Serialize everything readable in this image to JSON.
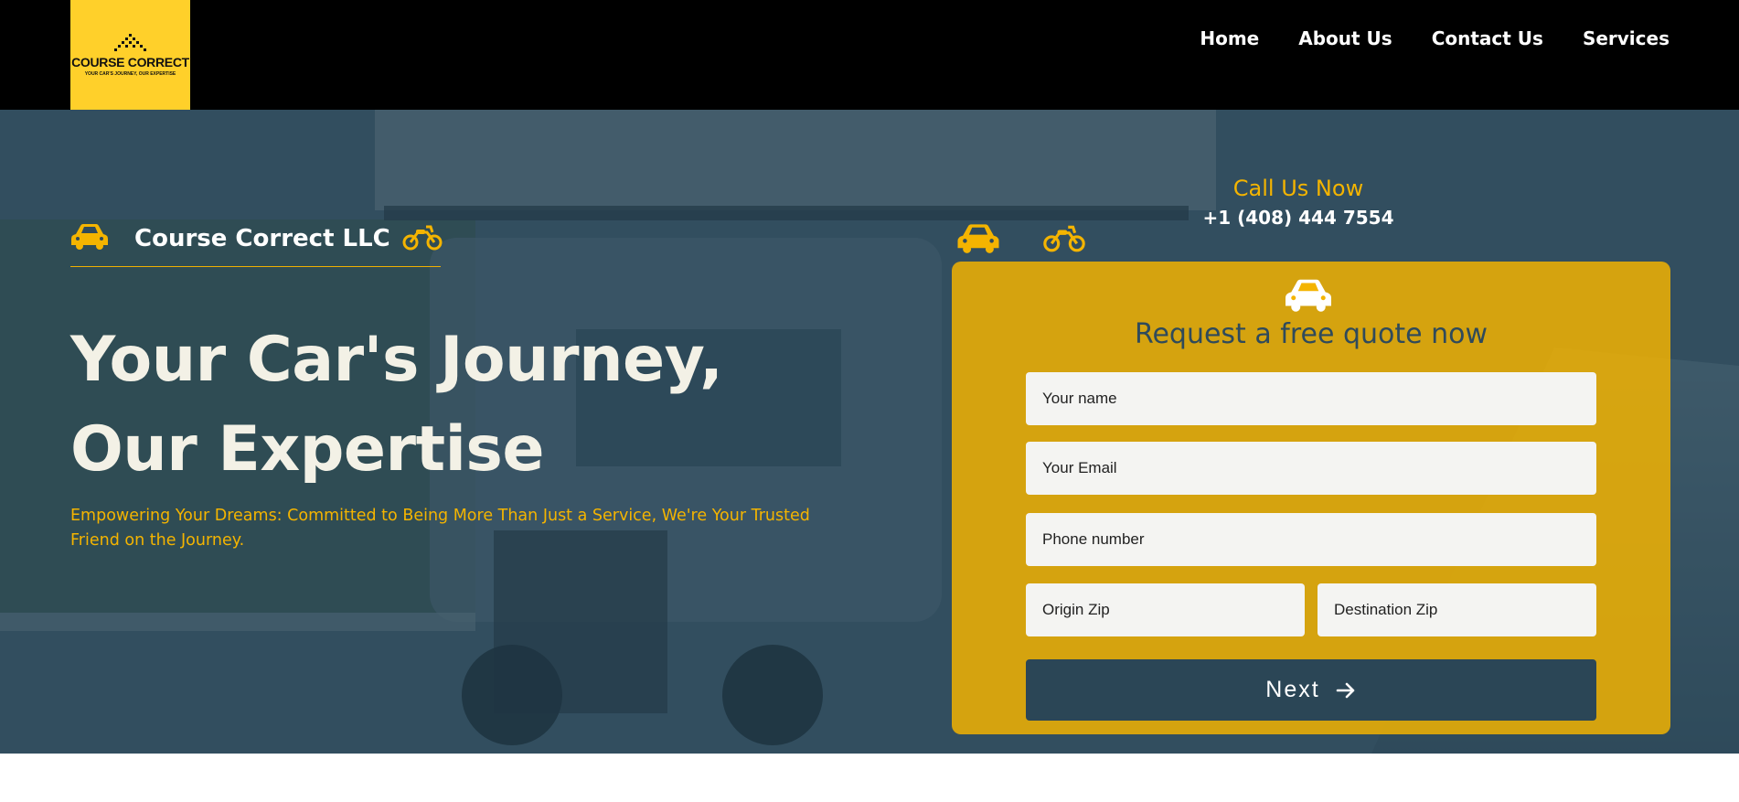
{
  "header": {
    "logo_name": "COURSE CORRECT",
    "logo_tagline": "YOUR CAR'S JOURNEY, OUR EXPERTISE",
    "nav": [
      "Home",
      "About Us",
      "Contact Us",
      "Services"
    ]
  },
  "hero": {
    "brand_name": "Course Correct LLC",
    "headline_line1": "Your Car's Journey,",
    "headline_line2": "Our Expertise",
    "tagline": "Empowering Your Dreams: Committed to Being More Than Just a Service, We're Your Trusted Friend on the Journey.",
    "call_title": "Call Us Now",
    "call_phone": "+1 (408) 444 7554"
  },
  "quote_form": {
    "title": "Request a free quote now",
    "name_placeholder": "Your name",
    "email_placeholder": "Your Email",
    "phone_placeholder": "Phone number",
    "origin_placeholder": "Origin Zip",
    "destination_placeholder": "Destination Zip",
    "next_label": "Next"
  },
  "icons": [
    "car-icon",
    "motorcycle-icon",
    "arrow-right-icon",
    "logo-mark-icon"
  ],
  "colors": {
    "brand_yellow": "#FFD02A",
    "accent_amber": "#F4B400",
    "header_black": "#000000",
    "button_navy": "#2B4656",
    "heading_cream": "#F3F1E6"
  }
}
